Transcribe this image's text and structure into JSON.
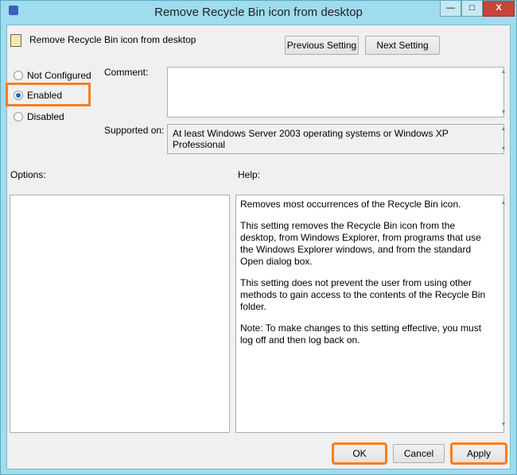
{
  "window": {
    "title": "Remove Recycle Bin icon from desktop",
    "min": "—",
    "max": "□",
    "close": "X"
  },
  "header": {
    "setting_name": "Remove Recycle Bin icon from desktop",
    "previous_label": "Previous Setting",
    "next_label": "Next Setting"
  },
  "state": {
    "options": [
      {
        "label": "Not Configured",
        "selected": false
      },
      {
        "label": "Enabled",
        "selected": true
      },
      {
        "label": "Disabled",
        "selected": false
      }
    ]
  },
  "comment": {
    "label": "Comment:",
    "value": ""
  },
  "supported": {
    "label": "Supported on:",
    "value": "At least Windows Server 2003 operating systems or Windows XP Professional"
  },
  "options_label": "Options:",
  "help": {
    "label": "Help:",
    "paragraphs": [
      "Removes most occurrences of the Recycle Bin icon.",
      "This setting removes the Recycle Bin icon from the desktop, from Windows Explorer, from programs that use the Windows Explorer windows, and from the standard Open dialog box.",
      "This setting does not prevent the user from using other methods to gain access to the contents of the Recycle Bin folder.",
      "Note: To make changes to this setting effective, you must log off and then log back on."
    ]
  },
  "footer": {
    "ok": "OK",
    "cancel": "Cancel",
    "apply": "Apply"
  },
  "colors": {
    "highlight": "#f57f20",
    "frame": "#9fdcef"
  }
}
